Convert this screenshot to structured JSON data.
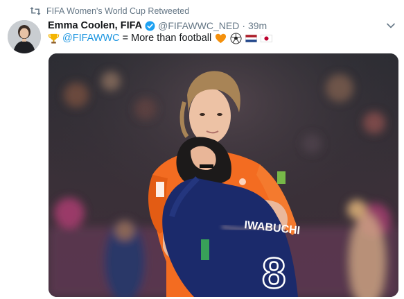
{
  "retweet": {
    "label": "FIFA Women's World Cup Retweeted"
  },
  "author": {
    "display_name": "Emma Coolen, FIFA",
    "handle": "@FIFAWWC_NED",
    "separator": "·",
    "timestamp": "39m",
    "verified": true
  },
  "tweet": {
    "mention": "@FIFAWWC",
    "text": " = More than football",
    "leading_icon": "trophy-icon",
    "trailing_icons": [
      "orange-heart-icon",
      "soccer-ball-icon",
      "netherlands-flag-icon",
      "japan-flag-icon"
    ]
  },
  "media": {
    "jersey_number": "8",
    "jersey_name": "IWABUCHI"
  },
  "colors": {
    "accent": "#1b95e0",
    "secondary_text": "#657786",
    "primary_text": "#14171a",
    "orange_kit": "#f36c21",
    "blue_kit": "#1b2a6b"
  }
}
